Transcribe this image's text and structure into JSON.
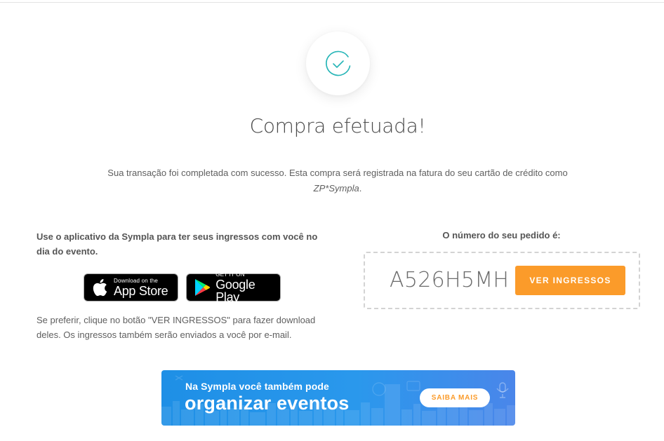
{
  "success": {
    "title": "Compra efetuada!",
    "description_part1": "Sua transação foi completada com sucesso. Esta compra será registrada na fatura do seu cartão de crédito como",
    "description_merchant": "ZP*Sympla",
    "description_end": "."
  },
  "app": {
    "heading": "Use o aplicativo da Sympla para ter seus ingressos com você no dia do evento.",
    "app_store": {
      "small": "Download on the",
      "big": "App Store"
    },
    "google_play": {
      "small": "GET IT ON",
      "big": "Google Play"
    },
    "help_text": "Se preferir, clique no botão \"VER INGRESSOS\" para fazer download deles. Os ingressos também serão enviados a você por e-mail."
  },
  "order": {
    "label": "O número do seu pedido é:",
    "code": "A526H5MH",
    "button_label": "VER INGRESSOS"
  },
  "banner": {
    "line1": "Na Sympla você também pode",
    "line2": "organizar eventos",
    "button_label": "SAIBA MAIS"
  },
  "colors": {
    "accent_orange": "#fb9b2a",
    "check_teal": "#26b5b7",
    "banner_blue": "#2a98ec"
  },
  "icons": [
    "check-icon",
    "apple-icon",
    "google-play-icon",
    "microphone-icon",
    "city-skyline"
  ]
}
